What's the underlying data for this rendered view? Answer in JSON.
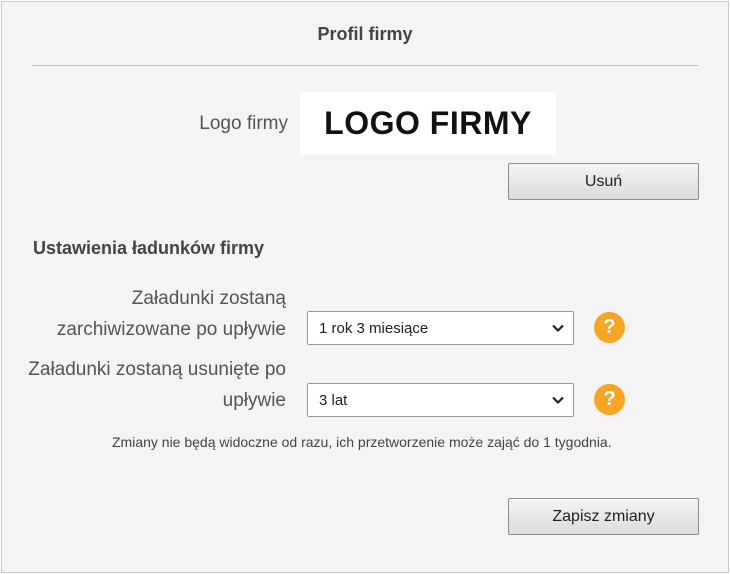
{
  "header": {
    "title": "Profil firmy"
  },
  "logo": {
    "label": "Logo firmy",
    "image_text": "LOGO FIRMY",
    "remove_label": "Usuń"
  },
  "settings": {
    "section_title": "Ustawienia ładunków firmy",
    "archive": {
      "label": "Załadunki zostaną zarchiwizowane po upływie",
      "selected": "1 rok 3 miesiące",
      "help_icon": "?"
    },
    "delete": {
      "label": "Załadunki zostaną usunięte po upływie",
      "selected": "3 lat",
      "help_icon": "?"
    },
    "note": "Zmiany nie będą widoczne od razu, ich przetworzenie może zająć do 1 tygodnia."
  },
  "footer": {
    "save_label": "Zapisz zmiany"
  },
  "colors": {
    "help_accent": "#f5a623",
    "panel_bg": "#f5f3f4"
  }
}
